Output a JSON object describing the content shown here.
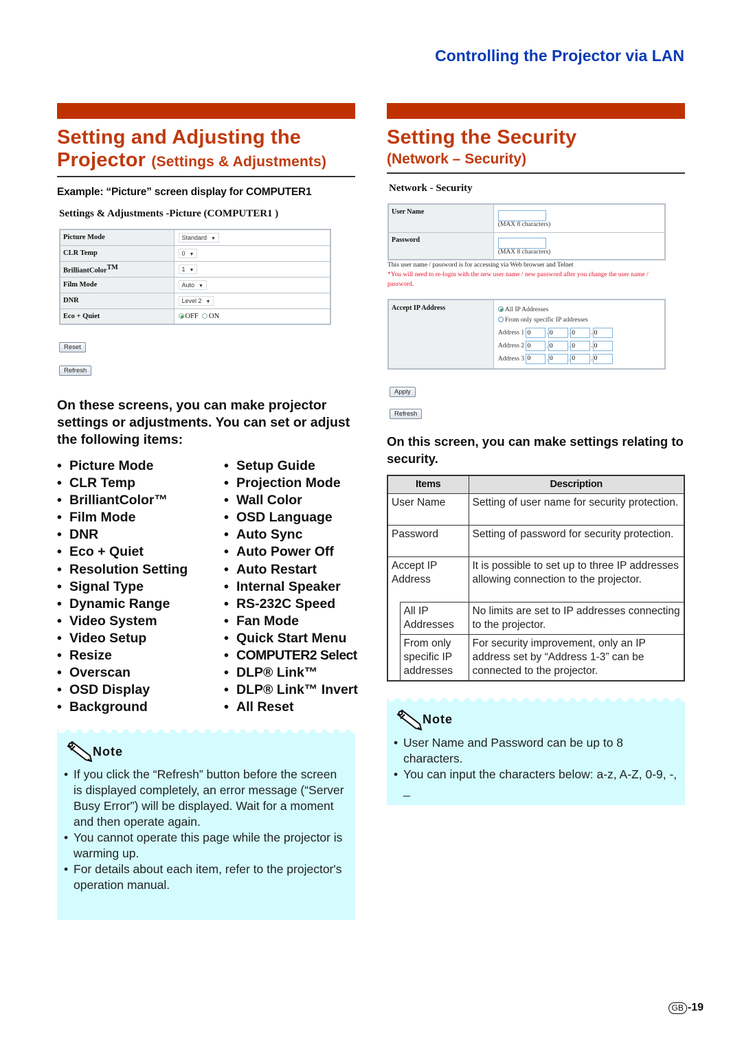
{
  "running_head": "Controlling the Projector via LAN",
  "colors": {
    "accent_red": "#bf3200",
    "title_red": "#c03a0e",
    "running_head_blue": "#0a3bb5",
    "note_bg": "#d4fcff"
  },
  "left": {
    "title_line1": "Setting and Adjusting the",
    "title_line2_main": "Projector",
    "title_line2_sub": "(Settings & Adjustments)",
    "example_caption": "Example:  “Picture” screen display for COMPUTER1",
    "screen": {
      "title": "Settings & Adjustments -Picture (COMPUTER1 )",
      "rows": [
        {
          "label": "Picture Mode",
          "type": "select",
          "value": "Standard"
        },
        {
          "label": "CLR Temp",
          "type": "select",
          "value": "0"
        },
        {
          "label": "BrilliantColor",
          "label_sup": "TM",
          "type": "select",
          "value": "1"
        },
        {
          "label": "Film Mode",
          "type": "select",
          "value": "Auto"
        },
        {
          "label": "DNR",
          "type": "select",
          "value": "Level 2"
        },
        {
          "label": "Eco + Quiet",
          "type": "radio",
          "options": [
            "OFF",
            "ON"
          ],
          "selected": "OFF"
        }
      ],
      "reset_button": "Reset",
      "refresh_button": "Refresh"
    },
    "lead": "On these screens, you can make projector settings or adjustments. You can set or adjust the following items:",
    "items_col1": [
      "Picture Mode",
      "CLR Temp",
      "BrilliantColor™",
      "Film Mode",
      "DNR",
      "Eco + Quiet",
      "Resolution Setting",
      "Signal Type",
      "Dynamic Range",
      "Video System",
      "Video Setup",
      "Resize",
      "Overscan",
      "OSD Display",
      "Background"
    ],
    "items_col2": [
      "Setup Guide",
      "Projection Mode",
      "Wall Color",
      "OSD Language",
      "Auto Sync",
      "Auto Power Off",
      "Auto Restart",
      "Internal Speaker",
      "RS-232C Speed",
      "Fan Mode",
      "Quick Start Menu",
      "COMPUTER2 Select",
      "DLP® Link™",
      "DLP® Link™ Invert",
      "All Reset"
    ],
    "note": {
      "heading": "Note",
      "items": [
        "If you click the “Refresh” button before the screen is displayed completely, an error message (“Server Busy Error”) will be displayed. Wait for a moment and then operate again.",
        "You cannot operate this page while the projector is warming up.",
        "For details about each item, refer to the projector's operation manual."
      ]
    }
  },
  "right": {
    "title": "Setting the Security",
    "subtitle": "(Network – Security)",
    "screen": {
      "title": "Network - Security",
      "user_name_label": "User Name",
      "user_name_value": "",
      "user_name_hint": "(MAX 8 characters)",
      "password_label": "Password",
      "password_value": "",
      "password_hint": "(MAX 8 characters)",
      "info_text": "This user name / password is for accessing via Web browser and Telnet",
      "warning_text": "*You will need to re-login with the new user name / new password after you change the user name / password.",
      "accept_ip_label": "Accept IP Address",
      "radio_all": "All IP Addresses",
      "radio_specific": "From only specific IP addresses",
      "radio_selected": "All IP Addresses",
      "addresses": [
        {
          "label": "Address 1",
          "octets": [
            "0",
            "0",
            "0",
            "0"
          ]
        },
        {
          "label": "Address 2",
          "octets": [
            "0",
            "0",
            "0",
            "0"
          ]
        },
        {
          "label": "Address 3",
          "octets": [
            "0",
            "0",
            "0",
            "0"
          ]
        }
      ],
      "apply_button": "Apply",
      "refresh_button": "Refresh"
    },
    "lead": "On this screen, you can make settings relating to security.",
    "table": {
      "headers": [
        "Items",
        "Description"
      ],
      "rows": [
        {
          "item": "User Name",
          "desc": "Setting of user name for security protection."
        },
        {
          "item": "Password",
          "desc": "Setting of password for security protection."
        },
        {
          "item": "Accept IP Address",
          "desc": "It is possible to set up to three IP addresses allowing connection to the projector."
        },
        {
          "item": "All IP Addresses",
          "desc": "No limits are set to IP addresses connecting to the projector.",
          "sub": true
        },
        {
          "item": "From only specific IP addresses",
          "desc": "For security improvement, only an IP address set by “Address 1-3” can be connected to the projector.",
          "sub": true
        }
      ]
    },
    "note": {
      "heading": "Note",
      "items": [
        "User Name and Password can be up to 8 characters.",
        "You can input the characters below: a-z, A-Z, 0-9, -, _"
      ]
    }
  },
  "footer": {
    "region_badge": "GB",
    "page_number": "-19"
  }
}
